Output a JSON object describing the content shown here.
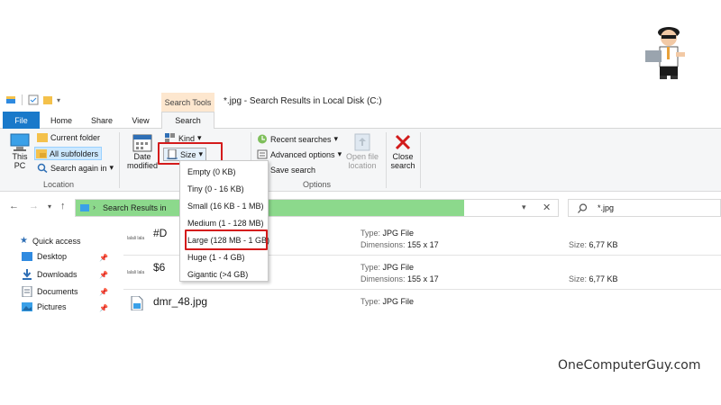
{
  "window": {
    "title": "*.jpg - Search Results in Local Disk (C:)",
    "context_tab_title": "Search Tools"
  },
  "tabs": [
    "File",
    "Home",
    "Share",
    "View",
    "Search"
  ],
  "ribbon": {
    "location": {
      "this_pc_line1": "This",
      "this_pc_line2": "PC",
      "current_folder": "Current folder",
      "all_subfolders": "All subfolders",
      "search_again": "Search again in",
      "label": "Location"
    },
    "refine": {
      "date_line1": "Date",
      "date_line2": "modified",
      "kind": "Kind",
      "size": "Size"
    },
    "options": {
      "recent": "Recent searches",
      "advanced": "Advanced options",
      "save": "Save search",
      "open_line1": "Open file",
      "open_line2": "location",
      "label": "Options"
    },
    "close": {
      "line1": "Close",
      "line2": "search"
    }
  },
  "size_menu": [
    "Empty (0 KB)",
    "Tiny (0 - 16 KB)",
    "Small (16 KB - 1 MB)",
    "Medium (1 - 128 MB)",
    "Large (128 MB - 1 GB)",
    "Huge (1 - 4 GB)",
    "Gigantic (>4 GB)"
  ],
  "address": {
    "text": "Search Results in",
    "search_value": "*.jpg"
  },
  "nav": [
    {
      "label": "Quick access"
    },
    {
      "label": "Desktop"
    },
    {
      "label": "Downloads"
    },
    {
      "label": "Documents"
    },
    {
      "label": "Pictures"
    }
  ],
  "results": [
    {
      "name": "#D",
      "type_label": "Type:",
      "type": "JPG File",
      "dim_label": "Dimensions:",
      "dim": "155 x 17",
      "size_label": "Size:",
      "size": "6,77 KB"
    },
    {
      "name": "$6",
      "type_label": "Type:",
      "type": "JPG File",
      "dim_label": "Dimensions:",
      "dim": "155 x 17",
      "size_label": "Size:",
      "size": "6,77 KB"
    },
    {
      "name": "dmr_48.jpg",
      "type_label": "Type:",
      "type": "JPG File",
      "dim_label": "",
      "dim": "",
      "size_label": "",
      "size": ""
    }
  ],
  "watermark": "OneComputerGuy.com",
  "colors": {
    "file_tab": "#1979ca",
    "context_tab": "#fde7cf",
    "highlight_box": "#d41b1b",
    "address_progress": "#8cd98c"
  }
}
